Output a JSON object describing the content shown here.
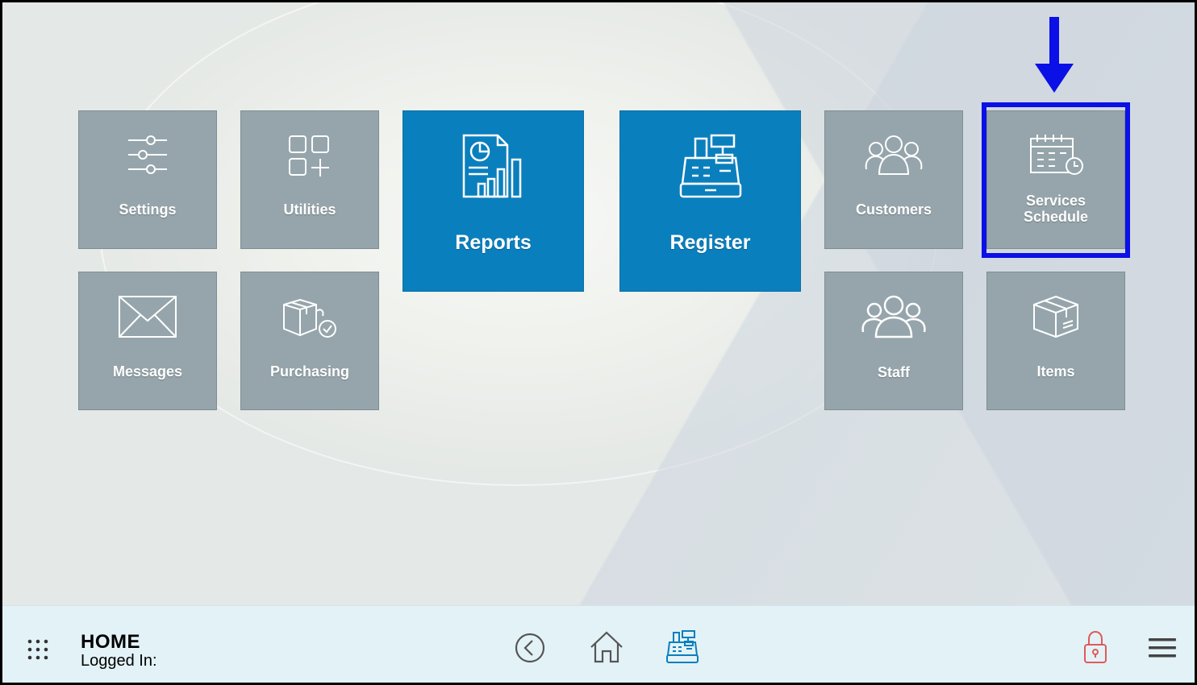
{
  "tiles": {
    "settings": "Settings",
    "utilities": "Utilities",
    "reports": "Reports",
    "register": "Register",
    "customers": "Customers",
    "services_schedule_line1": "Services",
    "services_schedule_line2": "Schedule",
    "messages": "Messages",
    "purchasing": "Purchasing",
    "staff": "Staff",
    "items": "Items"
  },
  "bottom_bar": {
    "title": "HOME",
    "logged_in_label": "Logged In:"
  },
  "icons": {
    "apps": "apps-grid-icon",
    "back": "back-circle-icon",
    "home": "home-icon",
    "register": "cash-register-icon",
    "lock": "lock-icon",
    "menu": "hamburger-menu-icon"
  },
  "colors": {
    "tile_gray": "#95a5ab",
    "tile_blue": "#0a7fbd",
    "highlight": "#0a10e6",
    "bottom_bar": "#e3f2f7",
    "lock_red": "#e05a5a"
  }
}
